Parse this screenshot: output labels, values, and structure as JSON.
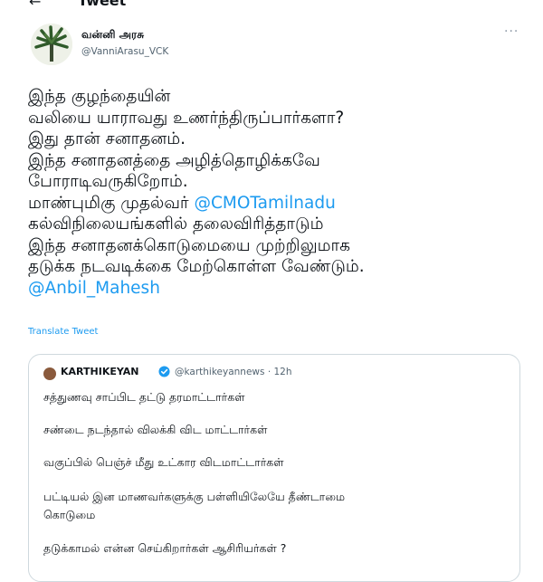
{
  "header": {
    "back_icon": "back-arrow-icon",
    "title": "Tweet"
  },
  "tweet": {
    "author_name": "வன்னி அரசு",
    "author_handle": "@VanniArasu_VCK",
    "more_icon": "more-horizontal-icon",
    "lines": [
      "இந்த குழந்தையின்",
      "வலியை யாராவது உணர்ந்திருப்பார்களா?",
      "இது தான் சனாதனம்.",
      "இந்த சனாதனத்தை அழித்தொழிக்கவே",
      "போராடிவருகிறோம்.",
      "மாண்புமிகு முதல்வர் ",
      "கல்விநிலையங்களில் தலைவிரித்தாடும்",
      "இந்த சனாதனக்கொடுமையை முற்றிலுமாக",
      "தடுக்க நடவடிக்கை மேற்கொள்ள வேண்டும்."
    ],
    "mention_cm": "@CMOTamilnadu",
    "mention_minister": "@Anbil_Mahesh",
    "translate_label": "Translate Tweet"
  },
  "quote": {
    "author_name": "KARTHIKEYAN",
    "verified_icon": "verified-badge-icon",
    "handle_time": "@karthikeyannews · 12h",
    "lines": [
      "சத்துணவு சாப்பிட தட்டு தரமாட்டார்கள்",
      "சண்டை நடந்தால் விலக்கி விட மாட்டார்கள்",
      "வகுப்பில் பெஞ்ச் மீது உட்கார விடமாட்டார்கள்",
      "பட்டியல் இன மாணவர்களுக்கு பள்ளியிலேயே தீண்டாமை",
      "கொடுமை",
      "தடுக்காமல் என்ன செய்கிறார்கள் ஆசிரியர்கள் ?"
    ]
  },
  "colors": {
    "link": "#1d9bf0",
    "secondary_text": "#536471",
    "border": "#cfd9de"
  }
}
